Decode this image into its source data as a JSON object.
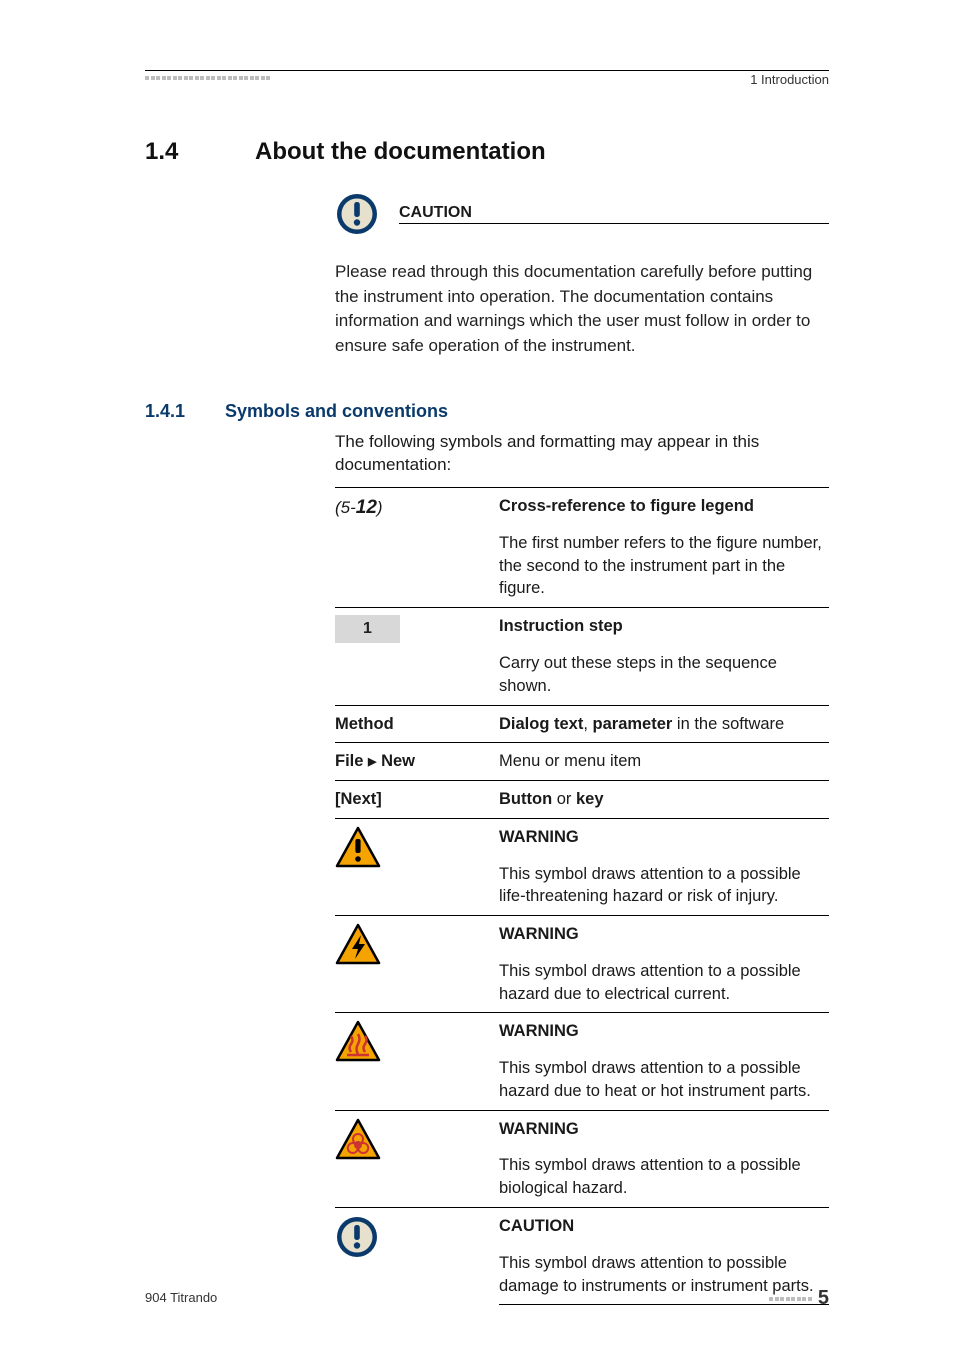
{
  "header": {
    "chapter": "1 Introduction"
  },
  "section": {
    "number": "1.4",
    "title": "About the documentation"
  },
  "caution_box": {
    "label": "CAUTION",
    "text": "Please read through this documentation carefully before putting the instrument into operation. The documentation contains information and warnings which the user must follow in order to ensure safe opera­tion of the instrument."
  },
  "subsection": {
    "number": "1.4.1",
    "title": "Symbols and conventions",
    "intro": "The following symbols and formatting may appear in this documentation:"
  },
  "rows": {
    "crossref": {
      "left_open": "(5-",
      "left_bold": "12",
      "left_close": ")",
      "head": "Cross-reference to figure legend",
      "body": "The first number refers to the figure number, the sec­ond to the instrument part in the figure."
    },
    "step": {
      "badge": "1",
      "head": "Instruction step",
      "body": "Carry out these steps in the sequence shown."
    },
    "method": {
      "left": "Method",
      "body_b1": "Dialog text",
      "body_mid": ", ",
      "body_b2": "parameter",
      "body_tail": " in the software"
    },
    "menu": {
      "left_a": "File",
      "left_b": "New",
      "body": "Menu or menu item"
    },
    "next": {
      "left": "[Next]",
      "body_b": "Button",
      "body_mid": " or ",
      "body_b2": "key"
    },
    "warn_triangle": {
      "head": "WARNING",
      "body": "This symbol draws attention to a possible life-threat­ening hazard or risk of injury."
    },
    "warn_electric": {
      "head": "WARNING",
      "body": "This symbol draws attention to a possible hazard due to electrical current."
    },
    "warn_heat": {
      "head": "WARNING",
      "body": "This symbol draws attention to a possible hazard due to heat or hot instrument parts."
    },
    "warn_bio": {
      "head": "WARNING",
      "body": "This symbol draws attention to a possible biological hazard."
    },
    "caution_instr": {
      "head": "CAUTION",
      "body": "This symbol draws attention to possible damage to instruments or instrument parts."
    }
  },
  "footer": {
    "product": "904 Titrando",
    "page": "5"
  }
}
